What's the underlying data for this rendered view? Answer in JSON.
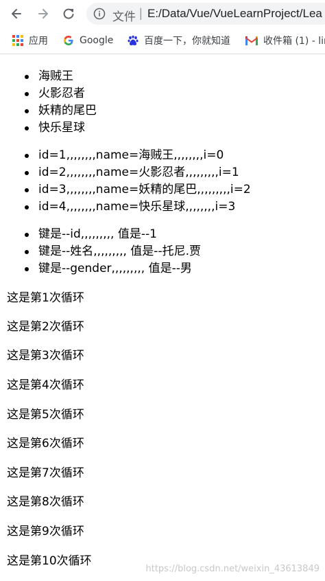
{
  "browser": {
    "address_label": "文件",
    "address_separator": "|",
    "url": "E:/Data/Vue/VueLearnProject/Lea",
    "bookmarks": [
      {
        "label": "应用",
        "icon": "apps-grid-icon"
      },
      {
        "label": "Google",
        "icon": "google-icon"
      },
      {
        "label": "百度一下，你就知道",
        "icon": "baidu-paw-icon"
      },
      {
        "label": "收件箱 (1) - lin",
        "icon": "gmail-icon"
      }
    ]
  },
  "lists": {
    "shows": [
      "海贼王",
      "火影忍者",
      "妖精的尾巴",
      "快乐星球"
    ],
    "indexed": [
      "id=1,,,,,,,,name=海贼王,,,,,,,,i=0",
      "id=2,,,,,,,,name=火影忍者,,,,,,,,,i=1",
      "id=3,,,,,,,,name=妖精的尾巴,,,,,,,,,i=2",
      "id=4,,,,,,,,name=快乐星球,,,,,,,,i=3"
    ],
    "object": [
      "键是--id,,,,,,,,, 值是--1",
      "键是--姓名,,,,,,,,, 值是--托尼.贾",
      "键是--gender,,,,,,,,, 值是--男"
    ]
  },
  "loops": [
    "这是第1次循环",
    "这是第2次循环",
    "这是第3次循环",
    "这是第4次循环",
    "这是第5次循环",
    "这是第6次循环",
    "这是第7次循环",
    "这是第8次循环",
    "这是第9次循环",
    "这是第10次循环"
  ],
  "watermark": "https://blog.csdn.net/weixin_43613849"
}
